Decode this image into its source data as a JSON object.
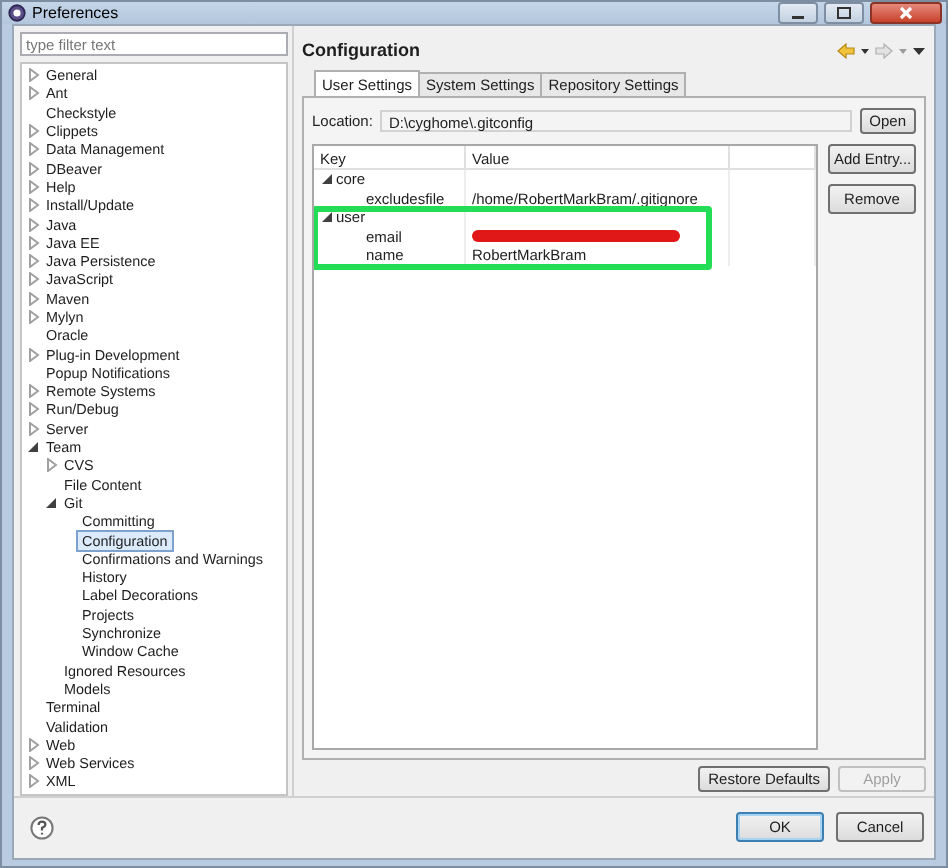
{
  "window": {
    "title": "Preferences"
  },
  "filter": {
    "placeholder": "type filter text"
  },
  "tree": [
    {
      "label": "General",
      "expanded": false,
      "selected": false
    },
    {
      "label": "Ant",
      "expanded": false,
      "selected": false
    },
    {
      "label": "Checkstyle",
      "selected": false
    },
    {
      "label": "Clippets",
      "expanded": false,
      "selected": false
    },
    {
      "label": "Data Management",
      "expanded": false,
      "selected": false
    },
    {
      "label": "DBeaver",
      "expanded": false,
      "selected": false
    },
    {
      "label": "Help",
      "expanded": false,
      "selected": false
    },
    {
      "label": "Install/Update",
      "expanded": false,
      "selected": false
    },
    {
      "label": "Java",
      "expanded": false,
      "selected": false
    },
    {
      "label": "Java EE",
      "expanded": false,
      "selected": false
    },
    {
      "label": "Java Persistence",
      "expanded": false,
      "selected": false
    },
    {
      "label": "JavaScript",
      "expanded": false,
      "selected": false
    },
    {
      "label": "Maven",
      "expanded": false,
      "selected": false
    },
    {
      "label": "Mylyn",
      "expanded": false,
      "selected": false
    },
    {
      "label": "Oracle",
      "selected": false
    },
    {
      "label": "Plug-in Development",
      "expanded": false,
      "selected": false
    },
    {
      "label": "Popup Notifications",
      "selected": false
    },
    {
      "label": "Remote Systems",
      "expanded": false,
      "selected": false
    },
    {
      "label": "Run/Debug",
      "expanded": false,
      "selected": false
    },
    {
      "label": "Server",
      "expanded": false,
      "selected": false
    },
    {
      "label": "Team",
      "expanded": true,
      "selected": false,
      "children": [
        {
          "label": "CVS",
          "expanded": false,
          "selected": false
        },
        {
          "label": "File Content",
          "selected": false
        },
        {
          "label": "Git",
          "expanded": true,
          "selected": false,
          "children": [
            {
              "label": "Committing",
              "selected": false
            },
            {
              "label": "Configuration",
              "selected": true
            },
            {
              "label": "Confirmations and Warnings",
              "selected": false
            },
            {
              "label": "History",
              "selected": false
            },
            {
              "label": "Label Decorations",
              "selected": false
            },
            {
              "label": "Projects",
              "selected": false
            },
            {
              "label": "Synchronize",
              "selected": false
            },
            {
              "label": "Window Cache",
              "selected": false
            }
          ]
        },
        {
          "label": "Ignored Resources",
          "selected": false
        },
        {
          "label": "Models",
          "selected": false
        }
      ]
    },
    {
      "label": "Terminal",
      "selected": false
    },
    {
      "label": "Validation",
      "selected": false
    },
    {
      "label": "Web",
      "expanded": false,
      "selected": false
    },
    {
      "label": "Web Services",
      "expanded": false,
      "selected": false
    },
    {
      "label": "XML",
      "expanded": false,
      "selected": false
    }
  ],
  "page": {
    "title": "Configuration"
  },
  "tabs": [
    {
      "label": "User Settings",
      "selected": true
    },
    {
      "label": "System Settings",
      "selected": false
    },
    {
      "label": "Repository Settings",
      "selected": false
    }
  ],
  "location": {
    "label": "Location:",
    "value": "D:\\cyghome\\.gitconfig",
    "button": "Open"
  },
  "table": {
    "columns": [
      "Key",
      "Value"
    ],
    "sections": [
      {
        "key": "core",
        "expanded": true,
        "highlighted": false,
        "entries": [
          {
            "key": "excludesfile",
            "value": "/home/RobertMarkBram/.gitignore",
            "redacted": false
          }
        ]
      },
      {
        "key": "user",
        "expanded": true,
        "highlighted": true,
        "entries": [
          {
            "key": "email",
            "redacted": true
          },
          {
            "key": "name",
            "value": "RobertMarkBram",
            "redacted": false
          }
        ]
      }
    ]
  },
  "side_buttons": [
    "Add Entry...",
    "Remove"
  ],
  "page_buttons": [
    {
      "label": "Restore Defaults",
      "disabled": false
    },
    {
      "label": "Apply",
      "disabled": true
    }
  ],
  "dialog_buttons": [
    {
      "label": "OK",
      "default": true
    },
    {
      "label": "Cancel",
      "default": false
    }
  ]
}
